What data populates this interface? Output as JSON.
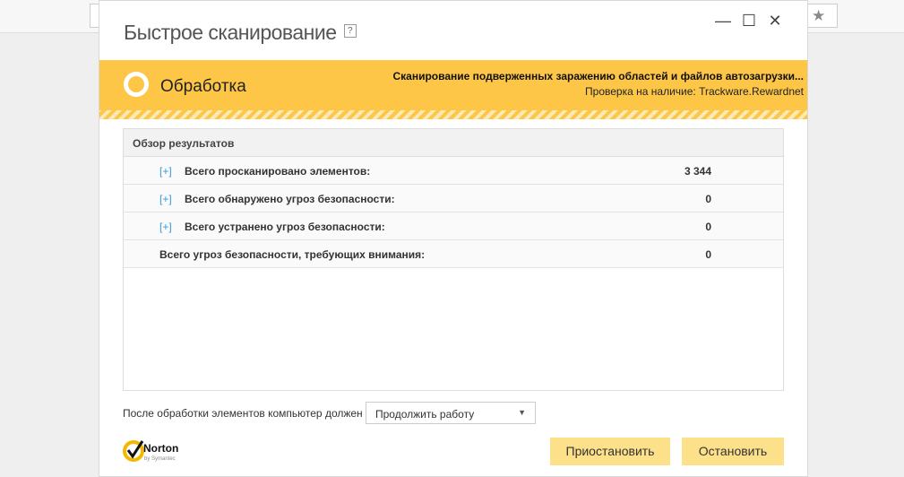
{
  "window": {
    "title": "Быстрое сканирование",
    "help": "?"
  },
  "status": {
    "label": "Обработка",
    "line1": "Сканирование подверженных заражению областей и файлов автозагрузки...",
    "line2": "Проверка на наличие: Trackware.Rewardnet",
    "color": "#fdc647"
  },
  "results": {
    "header": "Обзор результатов",
    "rows": [
      {
        "expand": "[+]",
        "label": "Всего просканировано элементов:",
        "value": "3 344"
      },
      {
        "expand": "[+]",
        "label": "Всего обнаружено угроз безопасности:",
        "value": "0"
      },
      {
        "expand": "[+]",
        "label": "Всего устранено угроз безопасности:",
        "value": "0"
      },
      {
        "label": "Всего угроз безопасности, требующих внимания:",
        "value": "0"
      }
    ]
  },
  "after": {
    "label": "После обработки элементов компьютер должен",
    "selected": "Продолжить работу"
  },
  "logo": {
    "name": "Norton",
    "sub": "by Symantec"
  },
  "buttons": {
    "pause": "Приостановить",
    "stop": "Остановить"
  }
}
